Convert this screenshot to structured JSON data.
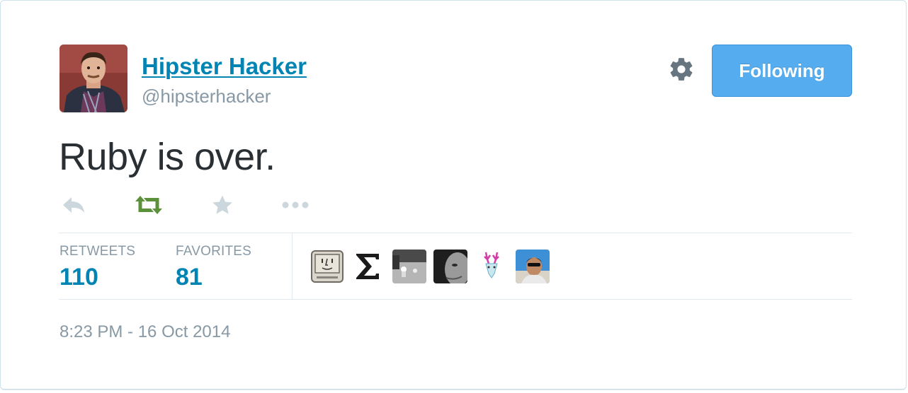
{
  "user": {
    "name": "Hipster Hacker",
    "handle": "@hipsterhacker",
    "follow_label": "Following"
  },
  "tweet": {
    "text": "Ruby is over.",
    "timestamp": "8:23 PM - 16 Oct 2014"
  },
  "actions": [
    {
      "name": "reply",
      "icon": "reply-icon"
    },
    {
      "name": "retweet",
      "icon": "retweet-icon",
      "color": "#5c913b"
    },
    {
      "name": "favorite",
      "icon": "star-icon"
    },
    {
      "name": "more",
      "icon": "more-icon"
    }
  ],
  "stats": {
    "retweets_label": "RETWEETS",
    "retweets_value": "110",
    "favorites_label": "FAVORITES",
    "favorites_value": "81"
  },
  "colors": {
    "link": "#0084b4",
    "button": "#55acee",
    "muted": "#8899a6",
    "icon": "#ccd6dd"
  }
}
